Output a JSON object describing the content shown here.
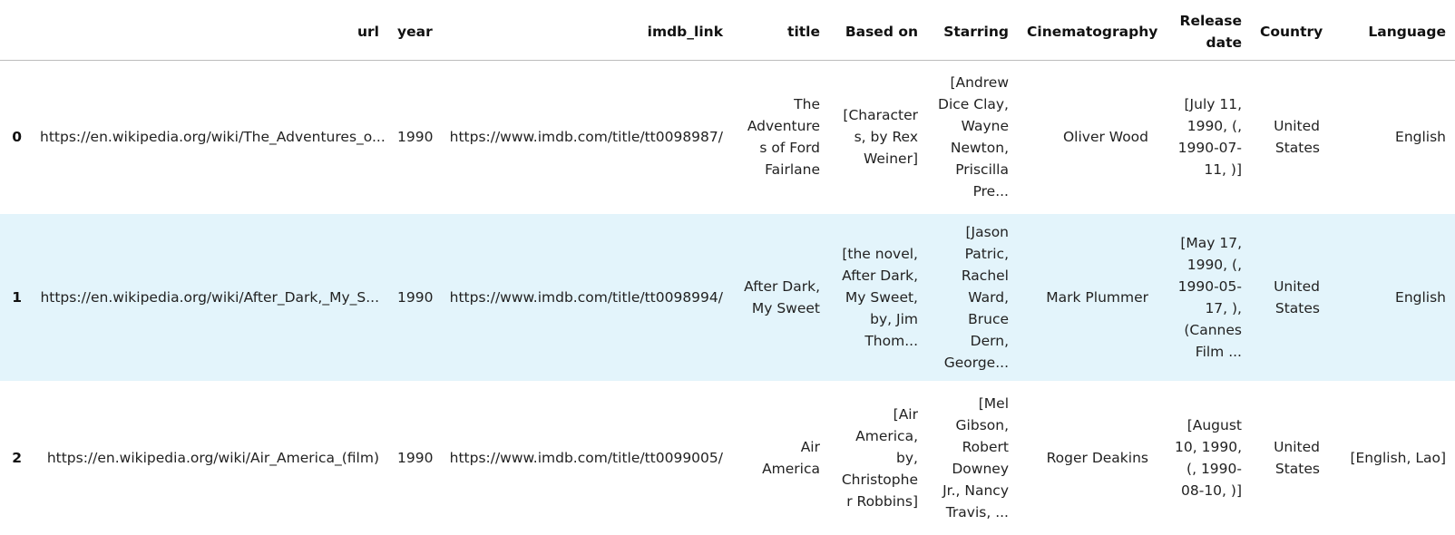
{
  "table": {
    "columns": [
      "url",
      "year",
      "imdb_link",
      "title",
      "Based on",
      "Starring",
      "Cinematography",
      "Release date",
      "Country",
      "Language"
    ],
    "rows": [
      {
        "index": "0",
        "cells": [
          "https://en.wikipedia.org/wiki/The_Adventures_o...",
          "1990",
          "https://www.imdb.com/title/tt0098987/",
          "The Adventures of Ford Fairlane",
          "[Characters, by Rex Weiner]",
          "[Andrew Dice Clay, Wayne Newton, Priscilla Pre...",
          "Oliver Wood",
          "[July 11, 1990, (, 1990-07-11, )]",
          "United States",
          "English"
        ]
      },
      {
        "index": "1",
        "cells": [
          "https://en.wikipedia.org/wiki/After_Dark,_My_S...",
          "1990",
          "https://www.imdb.com/title/tt0098994/",
          "After Dark, My Sweet",
          "[the novel, After Dark, My Sweet, by, Jim Thom...",
          "[Jason Patric, Rachel Ward, Bruce Dern, George...",
          "Mark Plummer",
          "[May 17, 1990, (, 1990-05-17, ), (Cannes Film ...",
          "United States",
          "English"
        ]
      },
      {
        "index": "2",
        "cells": [
          "https://en.wikipedia.org/wiki/Air_America_(film)",
          "1990",
          "https://www.imdb.com/title/tt0099005/",
          "Air America",
          "[Air America, by, Christopher Robbins]",
          "[Mel Gibson, Robert Downey Jr., Nancy Travis, ...",
          "Roger Deakins",
          "[August 10, 1990, (, 1990-08-10, )]",
          "United States",
          "[English, Lao]"
        ]
      }
    ]
  }
}
